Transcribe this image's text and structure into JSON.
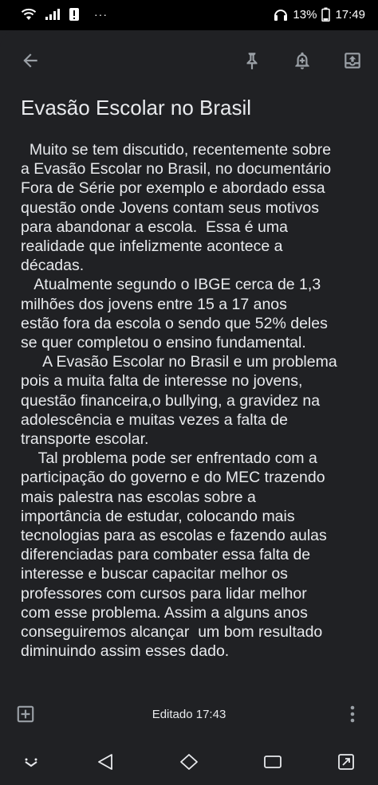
{
  "status_bar": {
    "time": "17:49",
    "battery": "13%",
    "more": "···"
  },
  "note": {
    "title": "Evasão Escolar no Brasil",
    "body": "  Muito se tem discutido, recentemente sobre\na Evasão Escolar no Brasil, no documentário\nFora de Série por exemplo e abordado essa\nquestão onde Jovens contam seus motivos\npara abandonar a escola.  Essa é uma\nrealidade que infelizmente acontece a\ndécadas.\n   Atualmente segundo o IBGE cerca de 1,3\nmilhões dos jovens entre 15 a 17 anos\nestão fora da escola o sendo que 52% deles\nse quer completou o ensino fundamental.\n     A Evasão Escolar no Brasil e um problema\npois a muita falta de interesse no jovens,\nquestão financeira,o bullying, a gravidez na\nadolescência e muitas vezes a falta de\ntransporte escolar.\n    Tal problema pode ser enfrentado com a\nparticipação do governo e do MEC trazendo\nmais palestra nas escolas sobre a\nimportância de estudar, colocando mais\ntecnologias para as escolas e fazendo aulas\ndiferenciadas para combater essa falta de\ninteresse e buscar capacitar melhor os\nprofessores com cursos para lidar melhor\ncom esse problema. Assim a alguns anos\nconseguiremos alcançar  um bom resultado\ndiminuindo assim esses dado."
  },
  "bottom_bar": {
    "edited_label": "Editado 17:43"
  },
  "icons": {
    "back": "arrow-left-icon",
    "pin": "pin-icon",
    "reminder": "bell-plus-icon",
    "archive": "archive-icon",
    "add": "add-box-icon",
    "more": "more-vert-icon"
  },
  "colors": {
    "background": "#202124",
    "text": "#e8eaed",
    "icon": "#9aa0a6",
    "status_bar": "#000000"
  }
}
